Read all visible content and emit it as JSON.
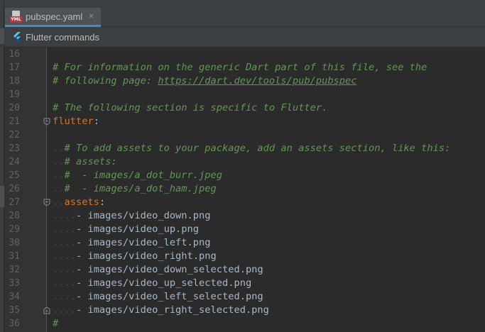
{
  "tab": {
    "filename": "pubspec.yaml",
    "icon": "yaml-file-icon",
    "badge": "YML",
    "close_symbol": "✕"
  },
  "notification": {
    "icon": "flutter-icon",
    "link_label": "Flutter commands"
  },
  "colors": {
    "comment": "#629755",
    "key": "#cc7832",
    "text": "#a9b7c6",
    "line_number": "#606366",
    "background": "#2b2b2b",
    "accent": "#4a88c7"
  },
  "editor": {
    "lines": [
      {
        "n": "16",
        "ws": "",
        "parts": []
      },
      {
        "n": "17",
        "ws": "",
        "parts": [
          {
            "t": "# For information on the generic Dart part of this file, see the",
            "c": "cm"
          }
        ]
      },
      {
        "n": "18",
        "ws": "",
        "parts": [
          {
            "t": "# following page: ",
            "c": "cm"
          },
          {
            "t": "https://dart.dev/tools/pub/pubspec",
            "c": "cm url"
          }
        ]
      },
      {
        "n": "19",
        "ws": "",
        "parts": []
      },
      {
        "n": "20",
        "ws": "",
        "parts": [
          {
            "t": "# The following section is specific to Flutter.",
            "c": "cm"
          }
        ]
      },
      {
        "n": "21",
        "ws": "",
        "fold": "open",
        "parts": [
          {
            "t": "flutter",
            "c": "key"
          },
          {
            "t": ":",
            "c": "punct"
          }
        ]
      },
      {
        "n": "22",
        "ws": "",
        "parts": []
      },
      {
        "n": "23",
        "ws": "..",
        "parts": [
          {
            "t": "# To add assets to your package, add an assets section, like this:",
            "c": "cm"
          }
        ]
      },
      {
        "n": "24",
        "ws": "..",
        "parts": [
          {
            "t": "# assets:",
            "c": "cm"
          }
        ]
      },
      {
        "n": "25",
        "ws": "..",
        "parts": [
          {
            "t": "#  - images/a_dot_burr.jpeg",
            "c": "cm"
          }
        ]
      },
      {
        "n": "26",
        "ws": "..",
        "parts": [
          {
            "t": "#  - images/a_dot_ham.jpeg",
            "c": "cm"
          }
        ]
      },
      {
        "n": "27",
        "ws": "..",
        "fold": "open",
        "parts": [
          {
            "t": "assets",
            "c": "key"
          },
          {
            "t": ":",
            "c": "punct"
          }
        ]
      },
      {
        "n": "28",
        "ws": "....",
        "parts": [
          {
            "t": "- images/video_down.png",
            "c": "val"
          }
        ]
      },
      {
        "n": "29",
        "ws": "....",
        "parts": [
          {
            "t": "- images/video_up.png",
            "c": "val"
          }
        ]
      },
      {
        "n": "30",
        "ws": "....",
        "parts": [
          {
            "t": "- images/video_left.png",
            "c": "val"
          }
        ]
      },
      {
        "n": "31",
        "ws": "....",
        "parts": [
          {
            "t": "- images/video_right.png",
            "c": "val"
          }
        ]
      },
      {
        "n": "32",
        "ws": "....",
        "parts": [
          {
            "t": "- images/video_down_selected.png",
            "c": "val"
          }
        ]
      },
      {
        "n": "33",
        "ws": "....",
        "parts": [
          {
            "t": "- images/video_up_selected.png",
            "c": "val"
          }
        ]
      },
      {
        "n": "34",
        "ws": "....",
        "parts": [
          {
            "t": "- images/video_left_selected.png",
            "c": "val"
          }
        ]
      },
      {
        "n": "35",
        "ws": "....",
        "fold": "close",
        "parts": [
          {
            "t": "- images/video_right_selected.png",
            "c": "val"
          }
        ]
      },
      {
        "n": "36",
        "ws": "",
        "parts": [
          {
            "t": "#",
            "c": "cm"
          }
        ]
      }
    ]
  }
}
